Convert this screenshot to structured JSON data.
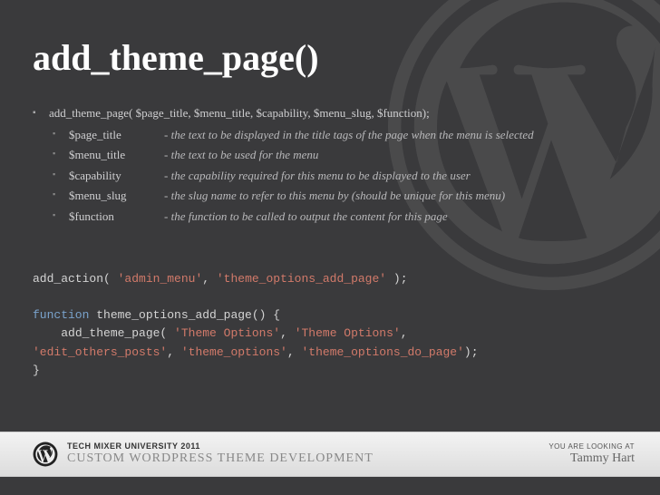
{
  "title": "add_theme_page()",
  "signature": "add_theme_page( $page_title, $menu_title, $capability, $menu_slug, $function);",
  "params": [
    {
      "name": "$page_title",
      "desc": "- the text to be displayed in the title tags of the page when the menu is selected"
    },
    {
      "name": "$menu_title",
      "desc": "- the text to be used for the menu"
    },
    {
      "name": "$capability",
      "desc": "- the capability required for this menu to be displayed to the user"
    },
    {
      "name": "$menu_slug",
      "desc": "- the slug name to refer to this menu by (should be unique for this menu)"
    },
    {
      "name": "$function",
      "desc": "- the function to be called to output the content for this page"
    }
  ],
  "code": {
    "line1_a": "add_action( ",
    "line1_s1": "'admin_menu'",
    "line1_b": ", ",
    "line1_s2": "'theme_options_add_page'",
    "line1_c": " );",
    "line2_kw": "function",
    "line2_rest": " theme_options_add_page() {",
    "line3_a": "    add_theme_page( ",
    "line3_s1": "'Theme Options'",
    "line3_b": ", ",
    "line3_s2": "'Theme Options'",
    "line3_c": ", ",
    "line4_s1": "'edit_others_posts'",
    "line4_a": ", ",
    "line4_s2": "'theme_options'",
    "line4_b": ", ",
    "line4_s3": "'theme_options_do_page'",
    "line4_c": ");",
    "line5": "}"
  },
  "footer": {
    "university": "TECH MIXER UNIVERSITY 2011",
    "course": "CUSTOM WORDPRESS THEME DEVELOPMENT",
    "lookingAt": "YOU ARE LOOKING AT",
    "presenter": "Tammy Hart"
  }
}
